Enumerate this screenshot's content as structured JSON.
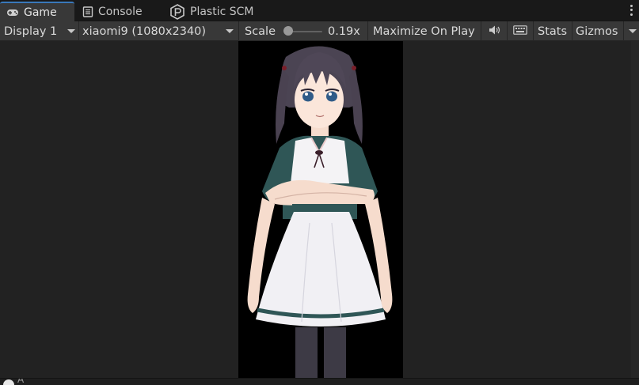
{
  "tabs": [
    {
      "label": "Game",
      "icon": "gamepad-icon",
      "active": true
    },
    {
      "label": "Console",
      "icon": "console-icon",
      "active": false
    },
    {
      "label": "Plastic SCM",
      "icon": "plastic-scm-icon",
      "active": false
    }
  ],
  "toolbar": {
    "display": "Display 1",
    "resolution": "xiaomi9 (1080x2340)",
    "scale_label": "Scale",
    "scale_value": "0.19x",
    "scale_fraction": 0.0,
    "maximize": "Maximize On Play",
    "stats": "Stats",
    "gizmos": "Gizmos"
  },
  "colors": {
    "accent": "#3a79bb",
    "panel": "#383838",
    "background": "#202020"
  },
  "status": {
    "message": "A"
  }
}
